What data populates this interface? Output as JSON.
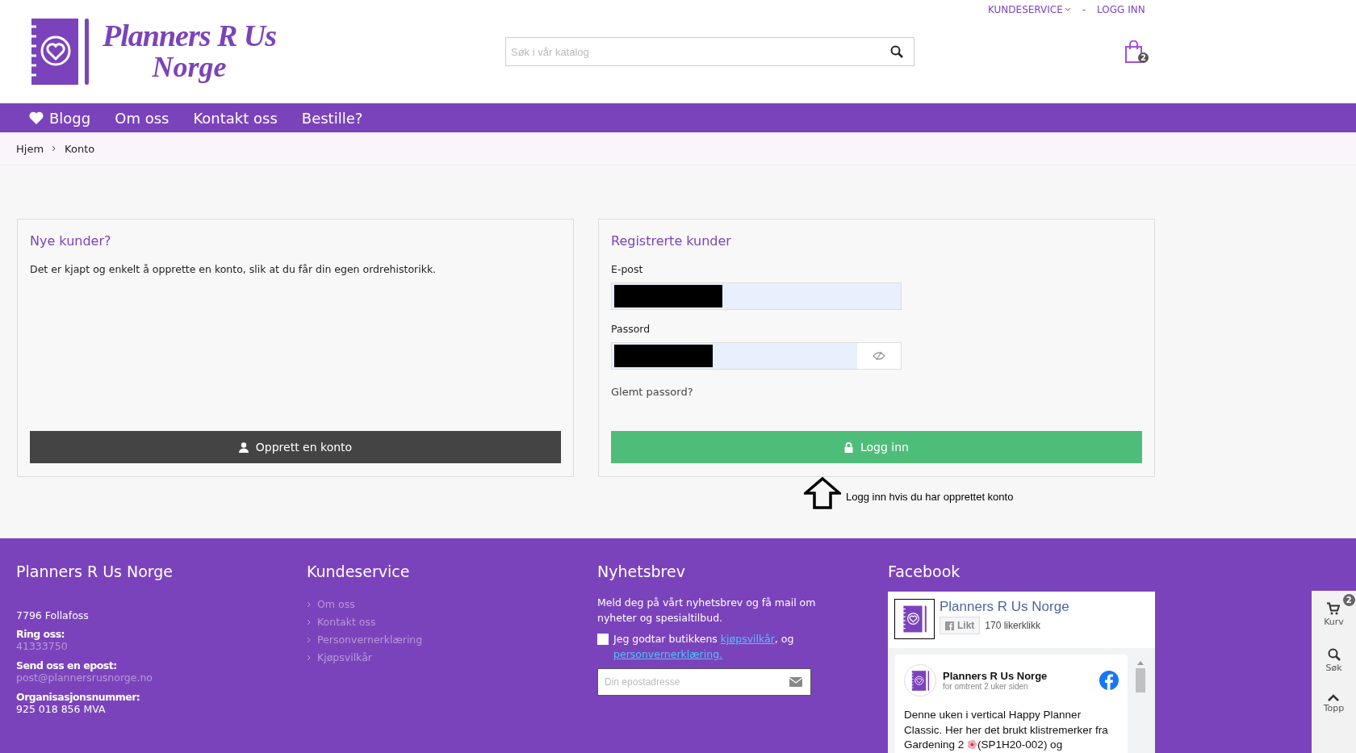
{
  "logo": {
    "line1": "Planners R Us",
    "line2": "Norge"
  },
  "top_links": [
    {
      "label": "KUNDESERVICE",
      "kind": "dropdown"
    },
    {
      "label": "-",
      "kind": "separator"
    },
    {
      "label": "LOGG INN",
      "kind": "link"
    }
  ],
  "search": {
    "placeholder": "Søk i vår katalog"
  },
  "cart": {
    "count": "2"
  },
  "nav": [
    {
      "label": "Blogg",
      "kind": "icon-link"
    },
    {
      "label": "Om oss",
      "kind": "link"
    },
    {
      "label": "Kontakt oss",
      "kind": "link"
    },
    {
      "label": "Bestille?",
      "kind": "link"
    }
  ],
  "breadcrumb": [
    "Hjem",
    "Konto"
  ],
  "new_customers": {
    "title": "Nye kunder?",
    "text": "Det er kjapt og enkelt å opprette en konto, slik at du får din egen ordrehistorikk.",
    "button": "Opprett en konto"
  },
  "registered": {
    "title": "Registrerte kunder",
    "email_label": "E-post",
    "password_label": "Passord",
    "forgot": "Glemt passord?",
    "button": "Logg inn"
  },
  "annotation": "Logg inn hvis du har opprettet konto",
  "footer": {
    "company": {
      "title": "Planners R Us Norge",
      "address": "7796 Follafoss",
      "phone_label": "Ring oss:",
      "phone": "41333750",
      "email_label": "Send oss en epost:",
      "email": "post@plannersrusnorge.no",
      "org_label": "Organisasjonsnummer:",
      "org": "925 018 856 MVA"
    },
    "service": {
      "title": "Kundeservice",
      "links": [
        "Om oss",
        "Kontakt oss",
        "Personvernerklæring",
        "Kjøpsvilkår"
      ]
    },
    "newsletter": {
      "title": "Nyhetsbrev",
      "text": "Meld deg på vårt nyhetsbrev og få mail om nyheter og spesialtilbud.",
      "consent_before": "Jeg godtar butikkens",
      "consent_link1": "kjøpsvilkår",
      "consent_between": ", og",
      "consent_link2": "personvernerklæring.",
      "checked": false,
      "placeholder": "Din epostadresse"
    },
    "facebook": {
      "title": "Facebook",
      "page_name": "Planners R Us Norge",
      "like": "Likt",
      "likes": "170 likerklikk",
      "post_author": "Planners R Us Norge",
      "post_time": "for omtrent 2 uker siden",
      "post_lines": [
        "Denne uken i vertical Happy Planner",
        "Classic. Her her det brukt klistremerker fra"
      ],
      "post_last_before": "Gardening 2",
      "post_last_after": "(SP1H20-002) og"
    }
  },
  "side_bar": [
    {
      "label": "Kurv",
      "kind": "cart",
      "badge": "2"
    },
    {
      "label": "Søk",
      "kind": "search"
    },
    {
      "label": "Topp",
      "kind": "top"
    }
  ]
}
